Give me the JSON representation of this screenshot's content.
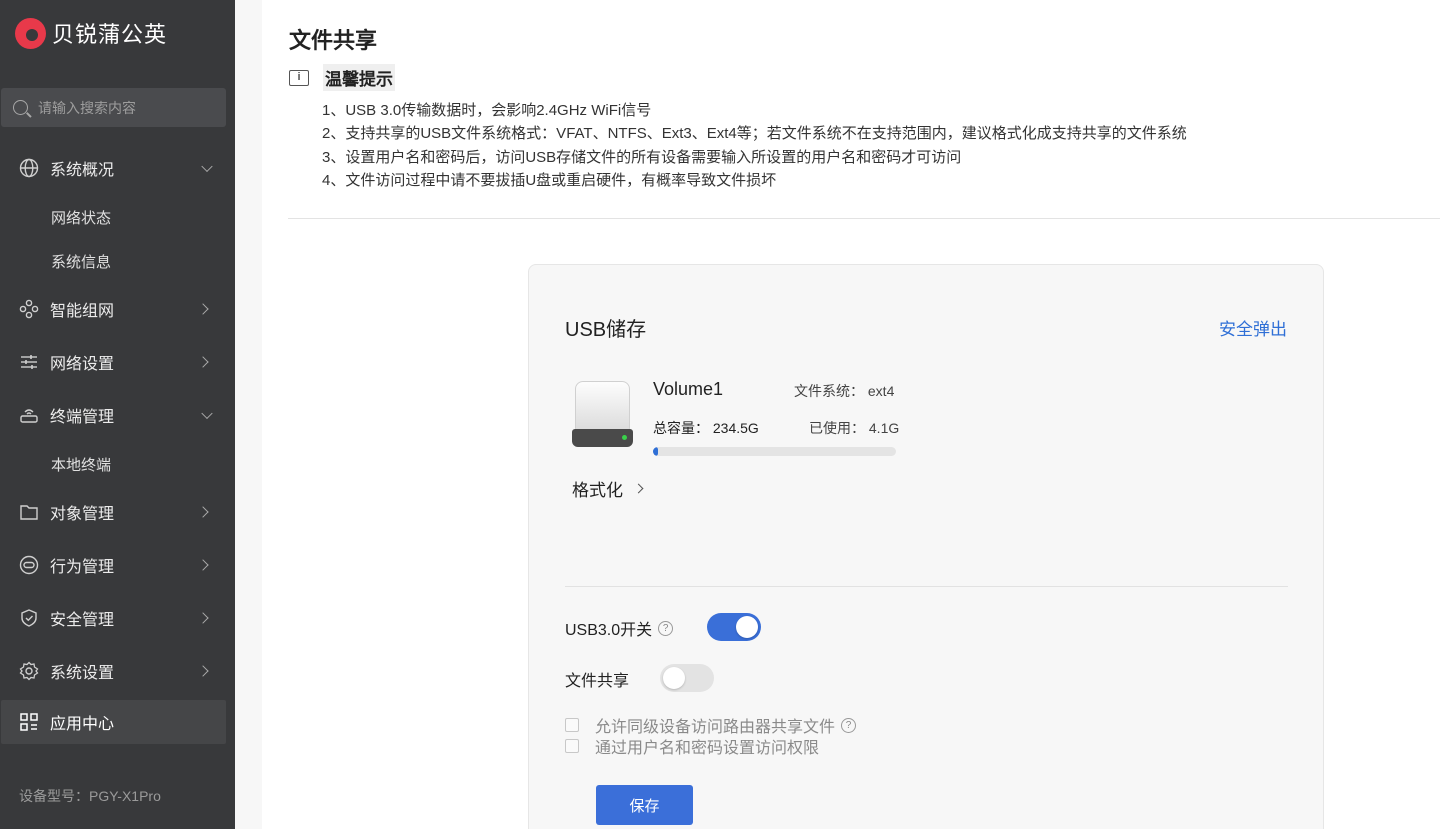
{
  "brand": {
    "name": "贝锐蒲公英",
    "accent": "#e8394a"
  },
  "search": {
    "placeholder": "请输入搜索内容"
  },
  "sidebar": {
    "items": [
      {
        "label": "系统概况",
        "icon": "globe-icon",
        "expanded": true
      },
      {
        "label": "智能组网",
        "icon": "network-icon"
      },
      {
        "label": "网络设置",
        "icon": "sliders-icon"
      },
      {
        "label": "终端管理",
        "icon": "router-icon",
        "expanded": true
      },
      {
        "label": "对象管理",
        "icon": "folder-icon"
      },
      {
        "label": "行为管理",
        "icon": "behavior-icon"
      },
      {
        "label": "安全管理",
        "icon": "shield-icon"
      },
      {
        "label": "系统设置",
        "icon": "gear-icon"
      },
      {
        "label": "应用中心",
        "icon": "apps-icon",
        "active": true
      }
    ],
    "sub_overview": [
      "网络状态",
      "系统信息"
    ],
    "sub_terminal": [
      "本地终端"
    ]
  },
  "device_model": "设备型号：PGY-X1Pro",
  "page": {
    "title": "文件共享",
    "tip_title": "温馨提示",
    "tips": [
      "1、USB 3.0传输数据时，会影响2.4GHz WiFi信号",
      "2、支持共享的USB文件系统格式：VFAT、NTFS、Ext3、Ext4等；若文件系统不在支持范围内，建议格式化成支持共享的文件系统",
      "3、设置用户名和密码后，访问USB存储文件的所有设备需要输入所设置的用户名和密码才可访问",
      "4、文件访问过程中请不要拔插U盘或重启硬件，有概率导致文件损坏"
    ]
  },
  "usb": {
    "title": "USB储存",
    "eject_label": "安全弹出",
    "volume_name": "Volume1",
    "filesystem": "文件系统： ext4",
    "total": "总容量： 234.5G",
    "used": "已使用： 4.1G",
    "usage_fraction": 0.0175,
    "format_label": "格式化",
    "usb3_label": "USB3.0开关",
    "usb3_on": true,
    "share_label": "文件共享",
    "share_on": false,
    "allow_peer_label": "允许同级设备访问路由器共享文件",
    "auth_label": "通过用户名和密码设置访问权限",
    "save_label": "保存",
    "primary_color": "#3b6fd9"
  }
}
